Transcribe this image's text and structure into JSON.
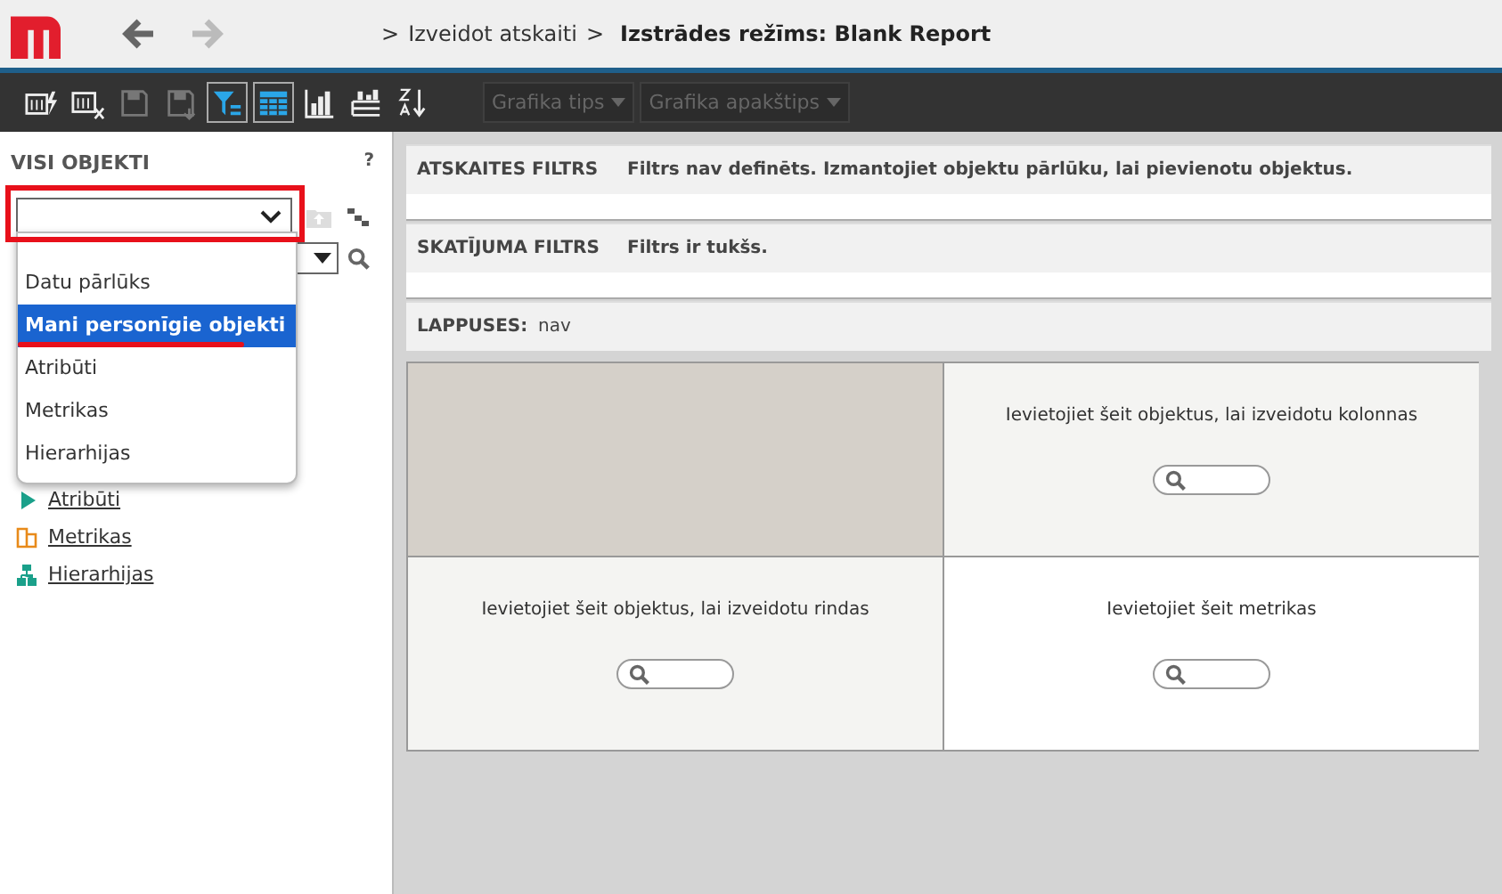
{
  "header": {
    "back_disabled": false,
    "forward_disabled": true,
    "breadcrumb": [
      {
        "separator": ">",
        "label": "Izveidot atskaiti",
        "current": false
      },
      {
        "separator": ">",
        "label": "Izstrādes režīms: Blank Report",
        "current": true
      }
    ]
  },
  "toolbar": {
    "tools": [
      {
        "kind": "run",
        "selected": false,
        "disabled": false
      },
      {
        "kind": "export",
        "selected": false,
        "disabled": false
      },
      {
        "kind": "save",
        "selected": false,
        "disabled": true
      },
      {
        "kind": "save-as",
        "selected": false,
        "disabled": true
      },
      {
        "kind": "filter",
        "selected": true,
        "disabled": false
      },
      {
        "kind": "grid",
        "selected": true,
        "disabled": false
      },
      {
        "kind": "chart",
        "selected": false,
        "disabled": false
      },
      {
        "kind": "grid-chart",
        "selected": false,
        "disabled": false
      },
      {
        "kind": "sort",
        "selected": false,
        "disabled": false
      }
    ],
    "dropdowns": [
      {
        "label": "Grafika tips",
        "disabled": true
      },
      {
        "label": "Grafika apakštips",
        "disabled": true
      }
    ]
  },
  "sidebar": {
    "title": "VISI OBJEKTI",
    "help": "?",
    "dropdown": {
      "expanded": true,
      "options": [
        {
          "label": "Datu pārlūks",
          "selected": false
        },
        {
          "label": "Mani personīgie objekti",
          "selected": true
        },
        {
          "label": "Atribūti",
          "selected": false
        },
        {
          "label": "Metrikas",
          "selected": false
        },
        {
          "label": "Hierarhijas",
          "selected": false
        }
      ]
    },
    "links": [
      {
        "label": "Atribūti",
        "kind": "attribute"
      },
      {
        "label": "Metrikas",
        "kind": "metric"
      },
      {
        "label": "Hierarhijas",
        "kind": "hierarchy"
      }
    ]
  },
  "filters": [
    {
      "label": "ATSKAITES FILTRS",
      "value": "Filtrs nav definēts. Izmantojiet objektu pārlūku, lai pievienotu objektus.",
      "kind": "filter"
    },
    {
      "label": "SKATĪJUMA FILTRS",
      "value": "Filtrs ir tukšs.",
      "kind": "filter"
    },
    {
      "label": "LAPPUSES:",
      "value": "nav",
      "kind": "pages"
    }
  ],
  "grid": [
    {
      "kind": "corner"
    },
    {
      "kind": "drop",
      "text": "Ievietojiet šeit objektus, lai izveidotu kolonnas"
    },
    {
      "kind": "drop",
      "text": "Ievietojiet šeit objektus, lai izveidotu rindas"
    },
    {
      "kind": "drop-white",
      "text": "Ievietojiet šeit metrikas"
    }
  ]
}
